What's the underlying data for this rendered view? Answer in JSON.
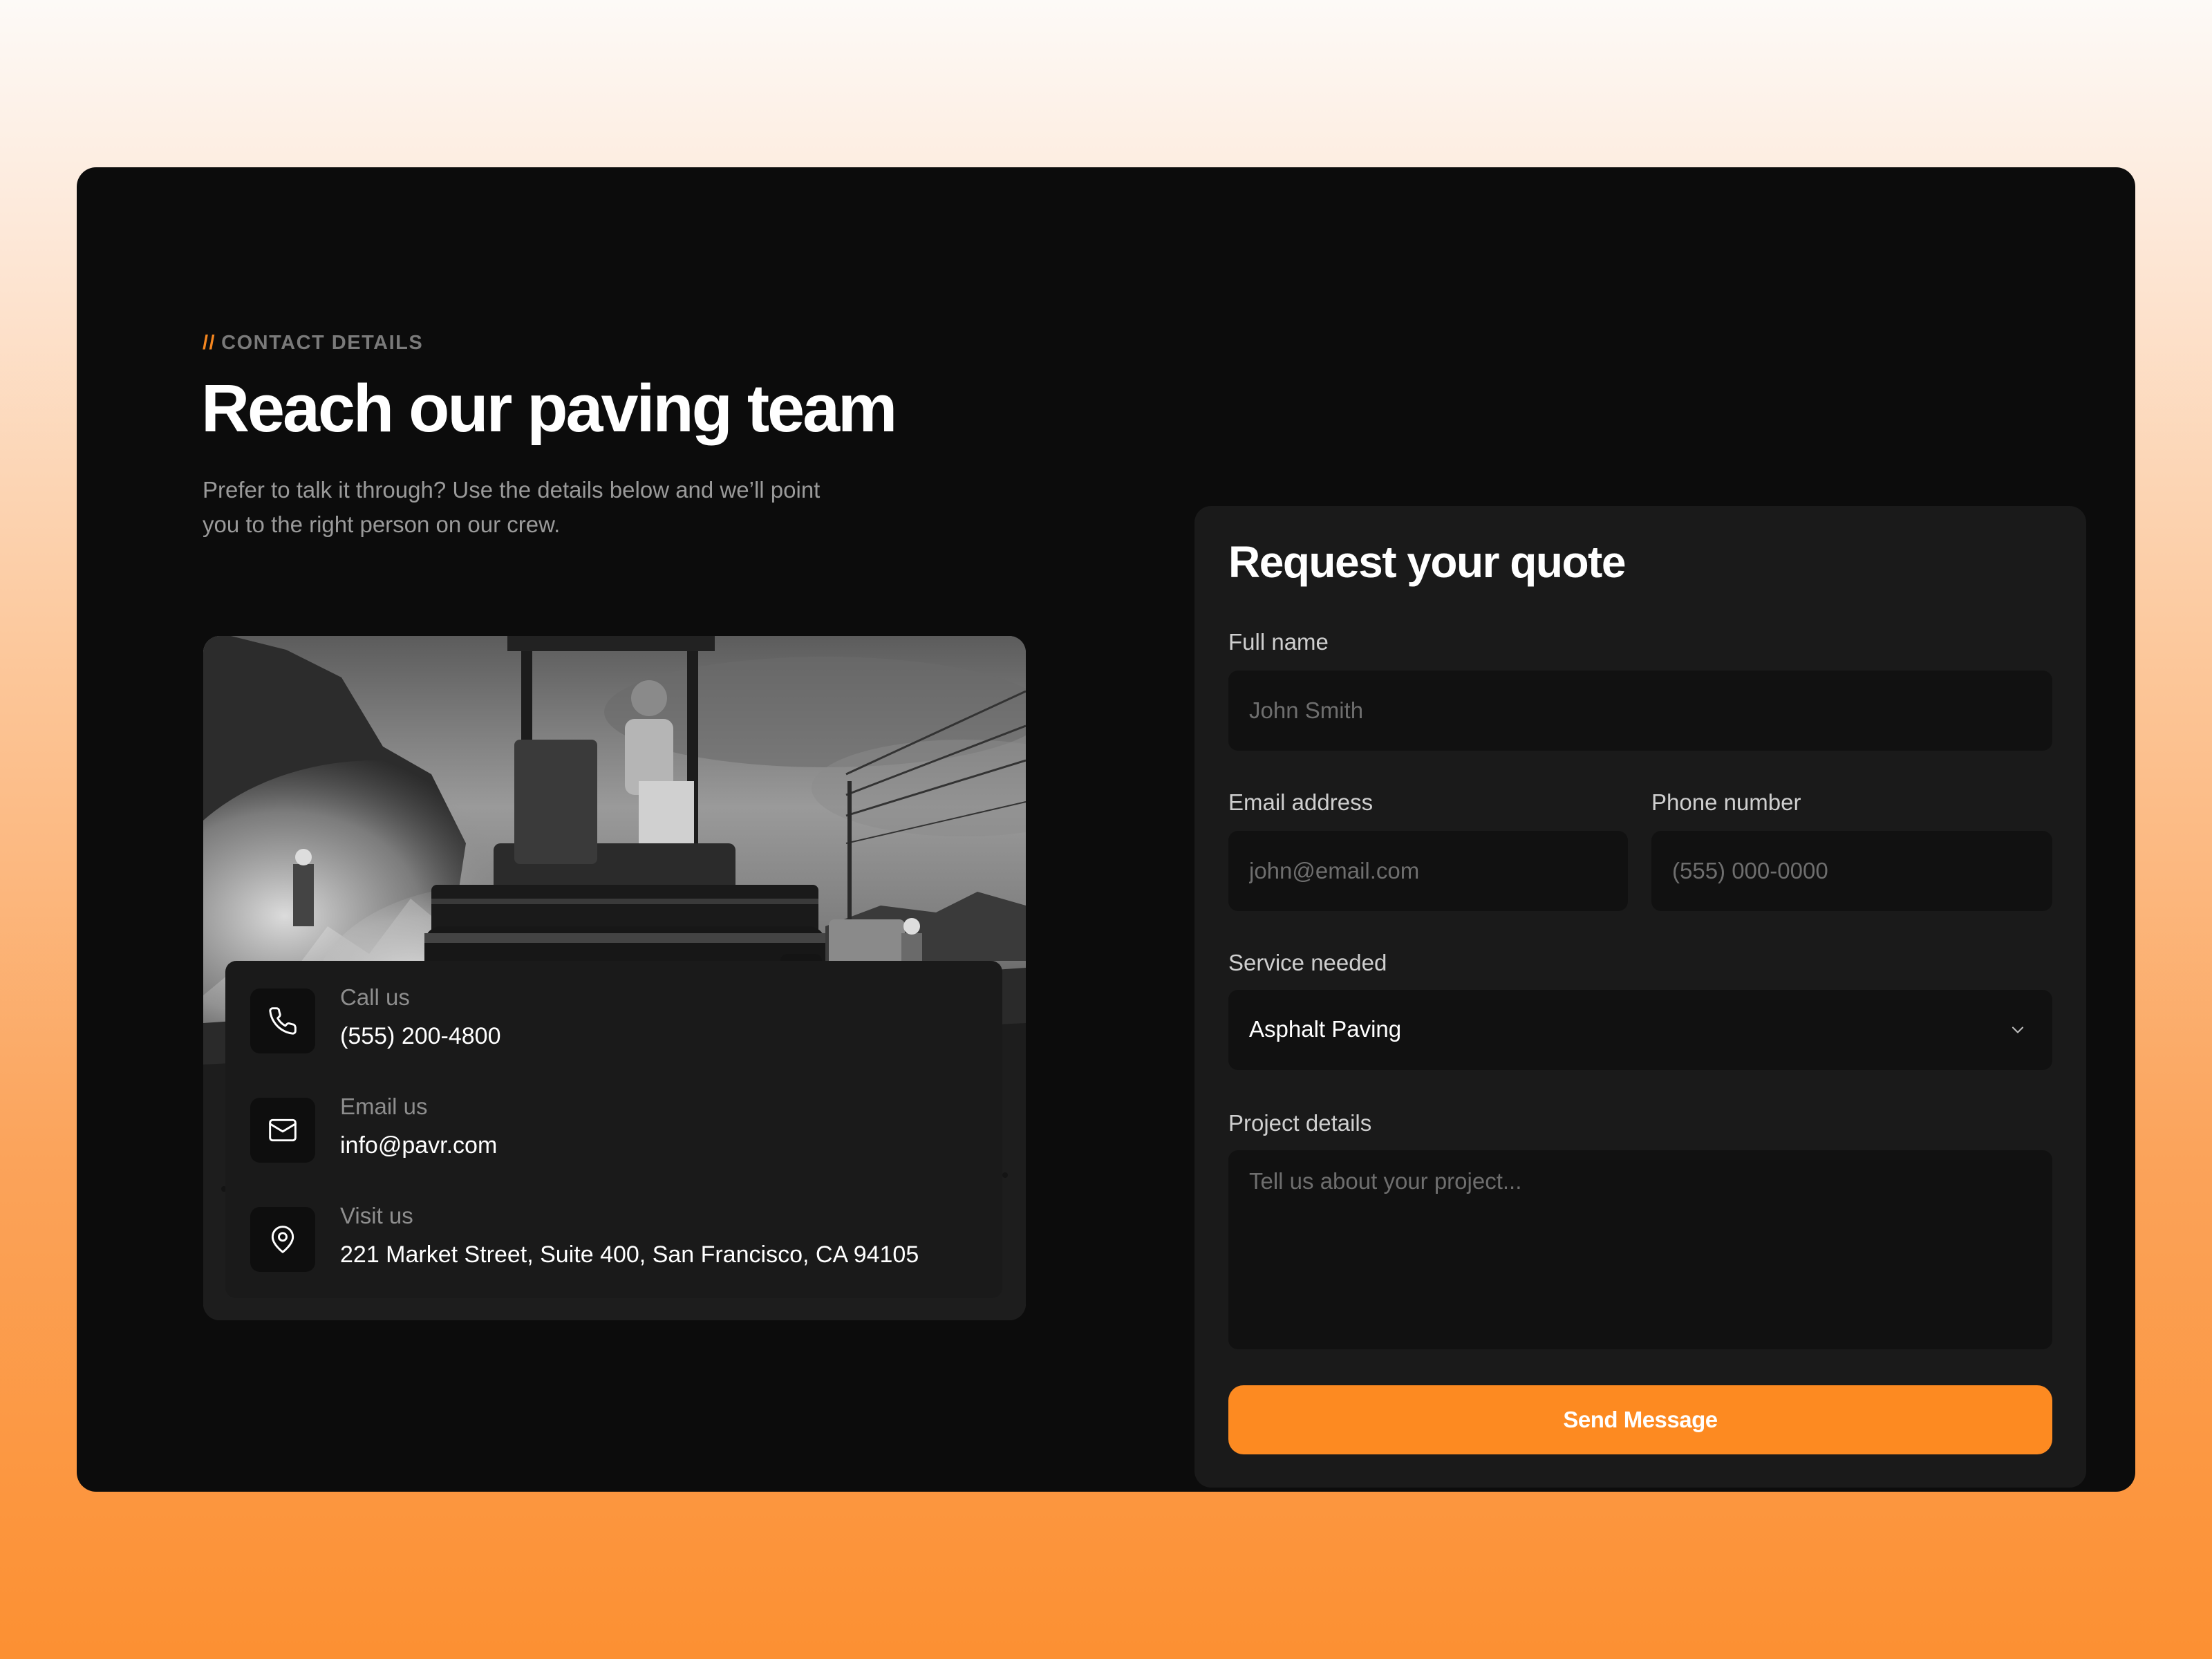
{
  "theme": {
    "accent": "#fd8a21",
    "card_background": "#0c0c0c",
    "panel_background": "#1a1a1a",
    "input_background": "#111111"
  },
  "contact": {
    "eyebrow_prefix": "//",
    "eyebrow": "CONTACT DETAILS",
    "headline": "Reach our paving team",
    "description": "Prefer to talk it through? Use the details below and we’ll point you to the right person on our crew.",
    "photo_icon": "paving-roller-photo",
    "items": [
      {
        "icon": "phone-icon",
        "label": "Call us",
        "value": "(555) 200-4800"
      },
      {
        "icon": "mail-icon",
        "label": "Email us",
        "value": "info@pavr.com"
      },
      {
        "icon": "map-pin-icon",
        "label": "Visit us",
        "value": "221 Market Street, Suite 400, San Francisco, CA 94105"
      }
    ]
  },
  "form": {
    "title": "Request your quote",
    "full_name": {
      "label": "Full name",
      "placeholder": "John Smith",
      "value": ""
    },
    "email": {
      "label": "Email address",
      "placeholder": "john@email.com",
      "value": ""
    },
    "phone": {
      "label": "Phone number",
      "placeholder": "(555) 000-0000",
      "value": ""
    },
    "service": {
      "label": "Service needed",
      "selected": "Asphalt Paving",
      "icon": "chevron-down-icon"
    },
    "details": {
      "label": "Project details",
      "placeholder": "Tell us about your project...",
      "value": ""
    },
    "submit_label": "Send Message"
  }
}
